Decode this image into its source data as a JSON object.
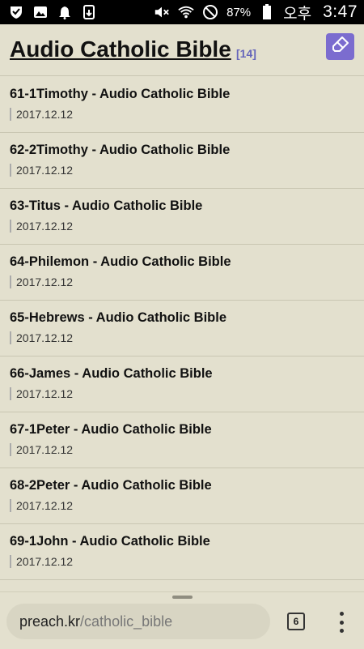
{
  "status_bar": {
    "battery": "87%",
    "ampm": "오후",
    "time": "3:47"
  },
  "header": {
    "title": "Audio Catholic Bible",
    "count": "[14]",
    "write_icon": "pencil-eraser-icon"
  },
  "posts": [
    {
      "title": "61-1Timothy - Audio Catholic Bible",
      "date": "2017.12.12"
    },
    {
      "title": "62-2Timothy - Audio Catholic Bible",
      "date": "2017.12.12"
    },
    {
      "title": "63-Titus - Audio Catholic Bible",
      "date": "2017.12.12"
    },
    {
      "title": "64-Philemon - Audio Catholic Bible",
      "date": "2017.12.12"
    },
    {
      "title": "65-Hebrews - Audio Catholic Bible",
      "date": "2017.12.12"
    },
    {
      "title": "66-James - Audio Catholic Bible",
      "date": "2017.12.12"
    },
    {
      "title": "67-1Peter - Audio Catholic Bible",
      "date": "2017.12.12"
    },
    {
      "title": "68-2Peter - Audio Catholic Bible",
      "date": "2017.12.12"
    },
    {
      "title": "69-1John - Audio Catholic Bible",
      "date": "2017.12.12"
    }
  ],
  "browser": {
    "url_host": "preach.kr",
    "url_path": "/catholic_bible",
    "tab_count": "6"
  },
  "colors": {
    "background": "#e3e0ce",
    "accent": "#7b6ccf",
    "count": "#6666bb"
  }
}
